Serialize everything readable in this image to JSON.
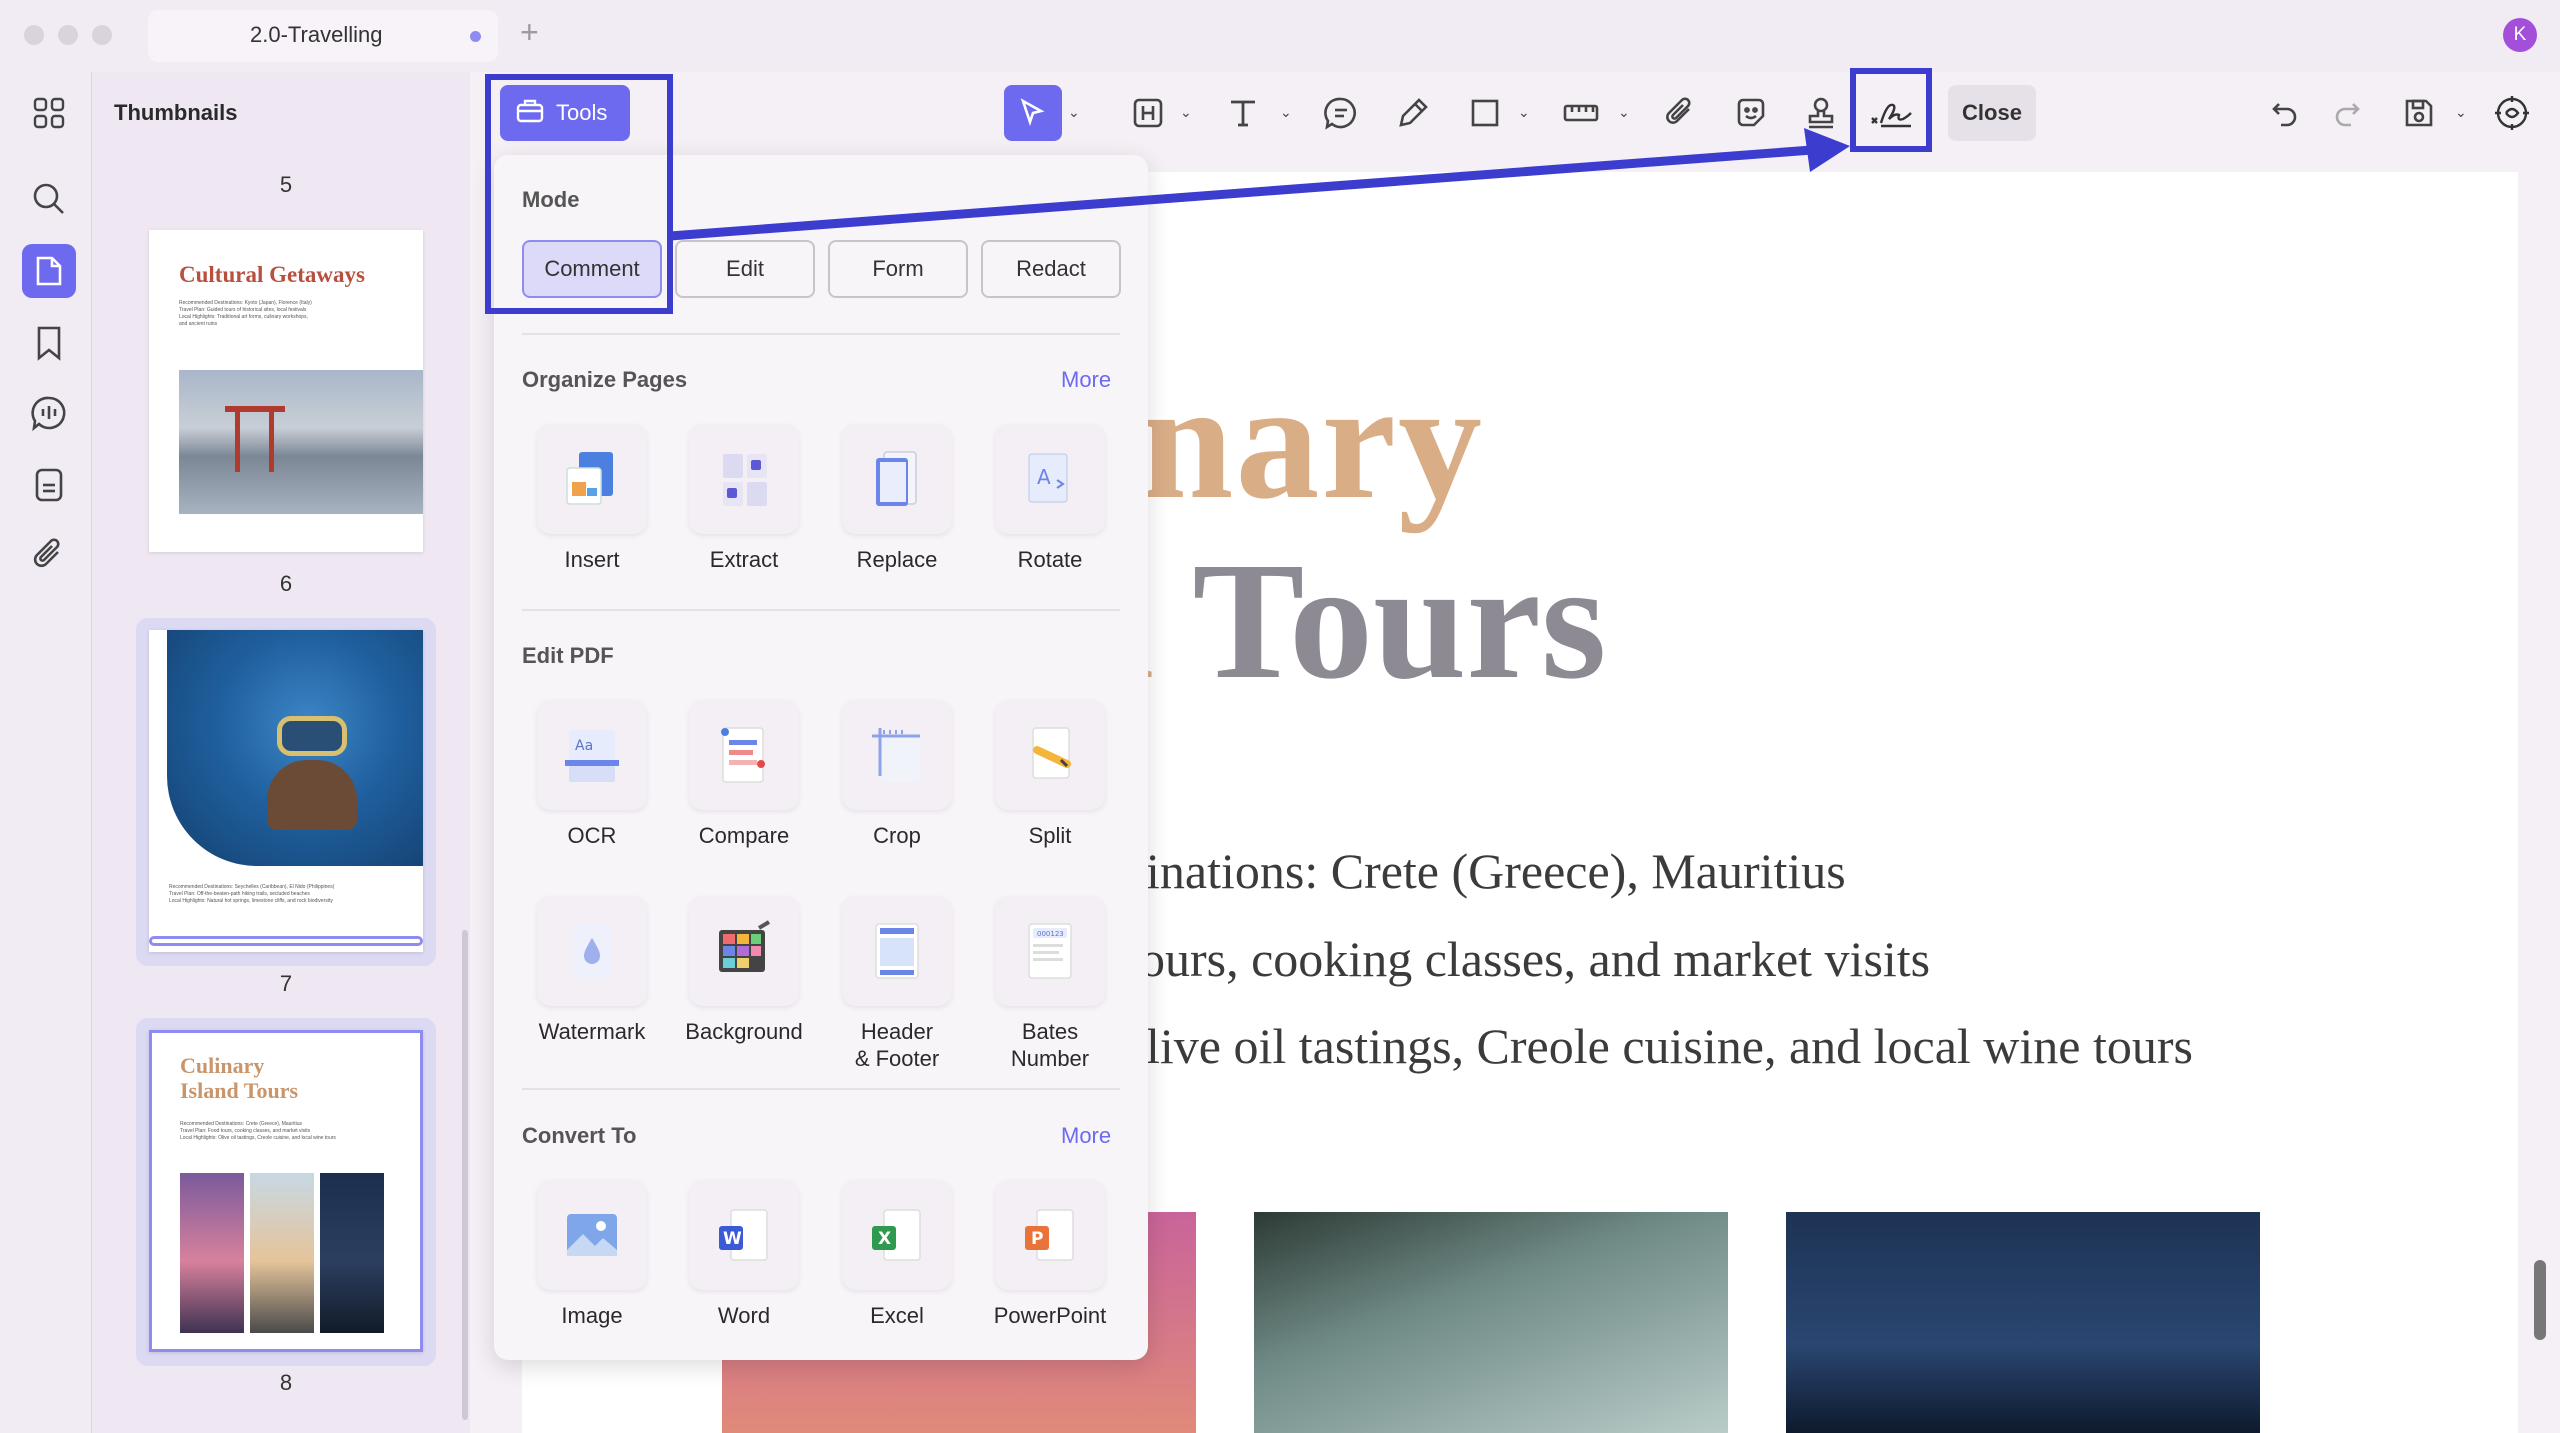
{
  "window": {
    "tab_title": "2.0-Travelling",
    "new_tab_icon": "plus-icon",
    "avatar_letter": "K"
  },
  "sidebar": {
    "icons": [
      "grid-icon",
      "search-icon",
      "pages-icon",
      "bookmark-icon",
      "ai-chat-icon",
      "form-icon",
      "attachment-icon"
    ],
    "active": "pages-icon"
  },
  "thumbnails": {
    "title": "Thumbnails",
    "pages": [
      {
        "number": "5"
      },
      {
        "number": "6",
        "title": "Cultural Getaways",
        "lines": [
          "Recommended Destinations: Kyoto (Japan), Florence (Italy)",
          "Travel Plan: Guided tours of historical sites, local festivals",
          "Local Highlights: Traditional art forms, culinary workshops,",
          "and ancient ruins"
        ]
      },
      {
        "number": "7",
        "lines": [
          "Recommended Destinations: Seychelles (Caribbean), El Nido (Philippines)",
          "Travel Plan: Off-the-beaten-path hiking trails, secluded beaches",
          "Local Highlights: Natural hot springs, limestone cliffs, and rock biodiversity"
        ]
      },
      {
        "number": "8",
        "title_line1": "Culinary",
        "title_line2": "Island Tours",
        "lines": [
          "Recommended Destinations: Crete (Greece), Mauritius",
          "Travel Plan: Food tours, cooking classes, and market visits",
          "Local Highlights: Olive oil tastings, Creole cuisine, and local wine tours"
        ]
      }
    ]
  },
  "toolbar": {
    "tools_label": "Tools",
    "close_label": "Close",
    "icons": [
      "select-cursor-icon",
      "highlight-icon",
      "text-icon",
      "comment-icon",
      "pen-icon",
      "shape-icon",
      "measure-icon",
      "attachment-icon",
      "sticker-icon",
      "stamp-icon",
      "signature-icon"
    ],
    "right_icons": [
      "undo-icon",
      "redo-icon",
      "save-icon",
      "ai-assistant-icon"
    ]
  },
  "tools_panel": {
    "mode": {
      "title": "Mode",
      "buttons": [
        "Comment",
        "Edit",
        "Form",
        "Redact"
      ],
      "selected": "Comment"
    },
    "organize": {
      "title": "Organize Pages",
      "more": "More",
      "items": [
        "Insert",
        "Extract",
        "Replace",
        "Rotate"
      ]
    },
    "edit": {
      "title": "Edit PDF",
      "items": [
        "OCR",
        "Compare",
        "Crop",
        "Split",
        "Watermark",
        "Background",
        "Header\n& Footer",
        "Bates\nNumber"
      ]
    },
    "convert": {
      "title": "Convert To",
      "more": "More",
      "items": [
        "Image",
        "Word",
        "Excel",
        "PowerPoint"
      ]
    }
  },
  "document": {
    "heading_line1": "nary",
    "heading_line2_faded": "d",
    "heading_line2": "Tours",
    "lines": [
      "inations: Crete (Greece), Mauritius",
      "ours, cooking classes, and market visits",
      "live oil tastings, Creole cuisine, and local wine tours"
    ]
  },
  "colors": {
    "accent": "#6d6af0",
    "annotation": "#3c3ccf",
    "heading_tan": "#d9ad86",
    "heading_gray": "#8d8a94"
  }
}
